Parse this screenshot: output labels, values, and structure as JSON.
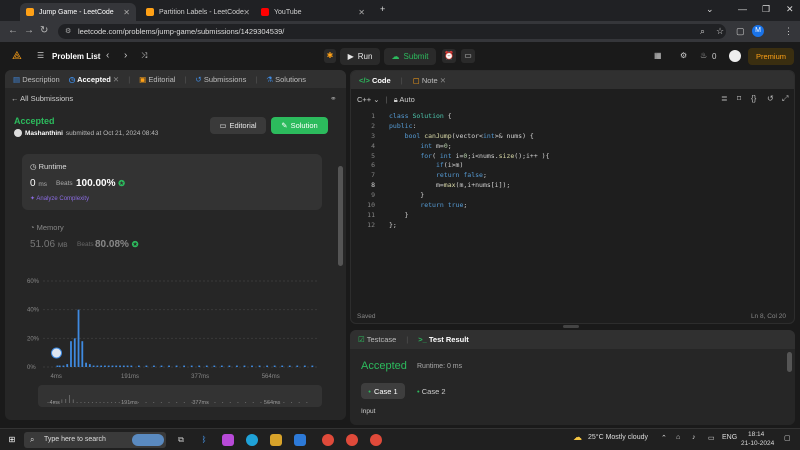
{
  "browser": {
    "tabs": [
      {
        "label": "Jump Game - LeetCode",
        "color": "#ffa116",
        "active": true
      },
      {
        "label": "Partition Labels - LeetCode",
        "color": "#ffa116",
        "active": false
      },
      {
        "label": "YouTube",
        "color": "#ff0000",
        "active": false
      }
    ],
    "url": "leetcode.com/problems/jump-game/submissions/1429304539/",
    "profile_initial": "M"
  },
  "topbar": {
    "problem_list": "Problem List",
    "run": "Run",
    "submit": "Submit",
    "streak": "0",
    "premium": "Premium"
  },
  "left_tabs": {
    "description": "Description",
    "accepted": "Accepted",
    "editorial": "Editorial",
    "submissions": "Submissions",
    "solutions": "Solutions"
  },
  "submission": {
    "back": "All Submissions",
    "status": "Accepted",
    "author": "Mashanthini",
    "submitted_text": "submitted at Oct 21, 2024 08:43",
    "editorial_btn": "Editorial",
    "solution_btn": "Solution"
  },
  "runtime": {
    "label": "Runtime",
    "value": "0",
    "unit": "ms",
    "beats_label": "Beats",
    "beats_pct": "100.00%",
    "analyze": "Analyze Complexity"
  },
  "memory": {
    "label": "Memory",
    "value": "51.06",
    "unit": "MB",
    "beats_label": "Beats",
    "beats_pct": "80.08%"
  },
  "chart_data": {
    "type": "bar",
    "y_ticks": [
      "60%",
      "40%",
      "20%",
      "0%"
    ],
    "ylim": [
      0,
      60
    ],
    "x_ticks": [
      "4ms",
      "191ms",
      "377ms",
      "564ms"
    ],
    "xlim": [
      0,
      700
    ],
    "bars": [
      {
        "x": 4,
        "value": 1
      },
      {
        "x": 10,
        "value": 1
      },
      {
        "x": 20,
        "value": 1
      },
      {
        "x": 30,
        "value": 2
      },
      {
        "x": 40,
        "value": 18
      },
      {
        "x": 50,
        "value": 20
      },
      {
        "x": 60,
        "value": 40
      },
      {
        "x": 70,
        "value": 18
      },
      {
        "x": 80,
        "value": 3
      },
      {
        "x": 90,
        "value": 2
      },
      {
        "x": 100,
        "value": 1
      },
      {
        "x": 110,
        "value": 1
      },
      {
        "x": 120,
        "value": 1
      },
      {
        "x": 130,
        "value": 1
      },
      {
        "x": 140,
        "value": 1
      },
      {
        "x": 150,
        "value": 1
      },
      {
        "x": 160,
        "value": 1
      },
      {
        "x": 170,
        "value": 1
      },
      {
        "x": 180,
        "value": 1
      },
      {
        "x": 190,
        "value": 1
      },
      {
        "x": 200,
        "value": 1
      },
      {
        "x": 220,
        "value": 1
      },
      {
        "x": 240,
        "value": 1
      },
      {
        "x": 260,
        "value": 1
      },
      {
        "x": 280,
        "value": 1
      },
      {
        "x": 300,
        "value": 1
      },
      {
        "x": 320,
        "value": 1
      },
      {
        "x": 340,
        "value": 1
      },
      {
        "x": 360,
        "value": 1
      },
      {
        "x": 380,
        "value": 1
      },
      {
        "x": 400,
        "value": 1
      },
      {
        "x": 420,
        "value": 1
      },
      {
        "x": 440,
        "value": 1
      },
      {
        "x": 460,
        "value": 1
      },
      {
        "x": 480,
        "value": 1
      },
      {
        "x": 500,
        "value": 1
      },
      {
        "x": 520,
        "value": 1
      },
      {
        "x": 540,
        "value": 1
      },
      {
        "x": 560,
        "value": 1
      },
      {
        "x": 580,
        "value": 1
      },
      {
        "x": 600,
        "value": 1
      },
      {
        "x": 620,
        "value": 1
      },
      {
        "x": 640,
        "value": 1
      },
      {
        "x": 660,
        "value": 1
      },
      {
        "x": 680,
        "value": 1
      }
    ],
    "bar_color": "#3f8ae0",
    "grid": true
  },
  "code_panel": {
    "code_tab": "Code",
    "note_tab": "Note",
    "language": "C++",
    "auto": "Auto",
    "saved": "Saved",
    "cursor": "Ln 8, Col 20",
    "lines": [
      "class Solution {",
      "public:",
      "    bool canJump(vector<int>& nums) {",
      "        int m=0;",
      "        for( int i=0;i<nums.size();i++ ){",
      "            if(i>m)",
      "            return false;",
      "            m=max(m,i+nums[i]);",
      "        }",
      "        return true;",
      "    }",
      "};"
    ]
  },
  "test_panel": {
    "testcase_tab": "Testcase",
    "result_tab": "Test Result",
    "status": "Accepted",
    "runtime": "Runtime: 0 ms",
    "case1": "Case 1",
    "case2": "Case 2",
    "input_label": "Input"
  },
  "taskbar": {
    "search": "Type here to search",
    "weather": "25°C  Mostly cloudy",
    "lang": "ENG",
    "time": "18:14",
    "date": "21-10-2024"
  }
}
